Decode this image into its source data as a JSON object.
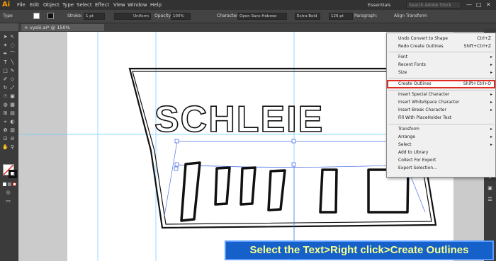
{
  "app": {
    "logo": "Ai"
  },
  "menubar": {
    "items": [
      "File",
      "Edit",
      "Object",
      "Type",
      "Select",
      "Effect",
      "View",
      "Window",
      "Help"
    ],
    "workspace": "Essentials",
    "search_placeholder": "Search Adobe Stock"
  },
  "control_bar": {
    "context_label": "Type",
    "stroke_label": "Stroke:",
    "stroke_value": "1 pt",
    "stroke_profile": "Uniform",
    "opacity_label": "Opacity:",
    "opacity_value": "100%",
    "character_label": "Character:",
    "font_family": "Open Sans Hebrew",
    "font_style": "Extra Bold",
    "font_size": "126 pt",
    "paragraph_label": "Paragraph:",
    "align_label": "Align",
    "transform_label": "Transform"
  },
  "document": {
    "tab_title": "vysiii.ai* @ 150% (CMYK/Preview)",
    "close": "×"
  },
  "artwork": {
    "top_text": "SCHLEIE",
    "bottom_text": "שלייי"
  },
  "context_menu": {
    "items": [
      {
        "label": "Undo Convert to Shape",
        "shortcut": "Ctrl+Z",
        "arrow": ""
      },
      {
        "label": "Redo Create Outlines",
        "shortcut": "Shift+Ctrl+Z",
        "arrow": ""
      },
      {
        "label": "Font",
        "shortcut": "",
        "arrow": "▸"
      },
      {
        "label": "Recent Fonts",
        "shortcut": "",
        "arrow": "▸"
      },
      {
        "label": "Size",
        "shortcut": "",
        "arrow": "▸"
      },
      {
        "label": "Create Outlines",
        "shortcut": "Shift+Ctrl+O",
        "arrow": ""
      },
      {
        "label": "Insert Special Character",
        "shortcut": "",
        "arrow": "▸"
      },
      {
        "label": "Insert WhiteSpace Character",
        "shortcut": "",
        "arrow": "▸"
      },
      {
        "label": "Insert Break Character",
        "shortcut": "",
        "arrow": "▸"
      },
      {
        "label": "Fill With PlaceHolder Text",
        "shortcut": "",
        "arrow": ""
      },
      {
        "label": "Transform",
        "shortcut": "",
        "arrow": "▸"
      },
      {
        "label": "Arrange",
        "shortcut": "",
        "arrow": "▸"
      },
      {
        "label": "Select",
        "shortcut": "",
        "arrow": "▸"
      },
      {
        "label": "Add to Library",
        "shortcut": "",
        "arrow": ""
      },
      {
        "label": "Collect For Export",
        "shortcut": "",
        "arrow": ""
      },
      {
        "label": "Export Selection...",
        "shortcut": "",
        "arrow": ""
      }
    ],
    "highlight_color": "#e02b20"
  },
  "banner": {
    "text": "Select the Text>Right click>Create Outlines",
    "bg": "#1560c9",
    "fg": "#f7ff8d"
  },
  "icons": [
    "selection-tool-icon",
    "direct-selection-tool-icon",
    "pen-tool-icon",
    "type-tool-icon",
    "line-tool-icon",
    "rectangle-tool-icon",
    "brush-tool-icon",
    "pencil-tool-icon",
    "eraser-tool-icon",
    "rotate-tool-icon",
    "scale-tool-icon",
    "warp-tool-icon",
    "free-transform-icon",
    "shape-builder-icon",
    "perspective-grid-icon",
    "mesh-tool-icon",
    "gradient-tool-icon",
    "eyedropper-tool-icon",
    "blend-tool-icon",
    "symbol-sprayer-icon",
    "column-graph-icon",
    "artboard-tool-icon",
    "slice-tool-icon",
    "hand-tool-icon",
    "zoom-tool-icon"
  ]
}
